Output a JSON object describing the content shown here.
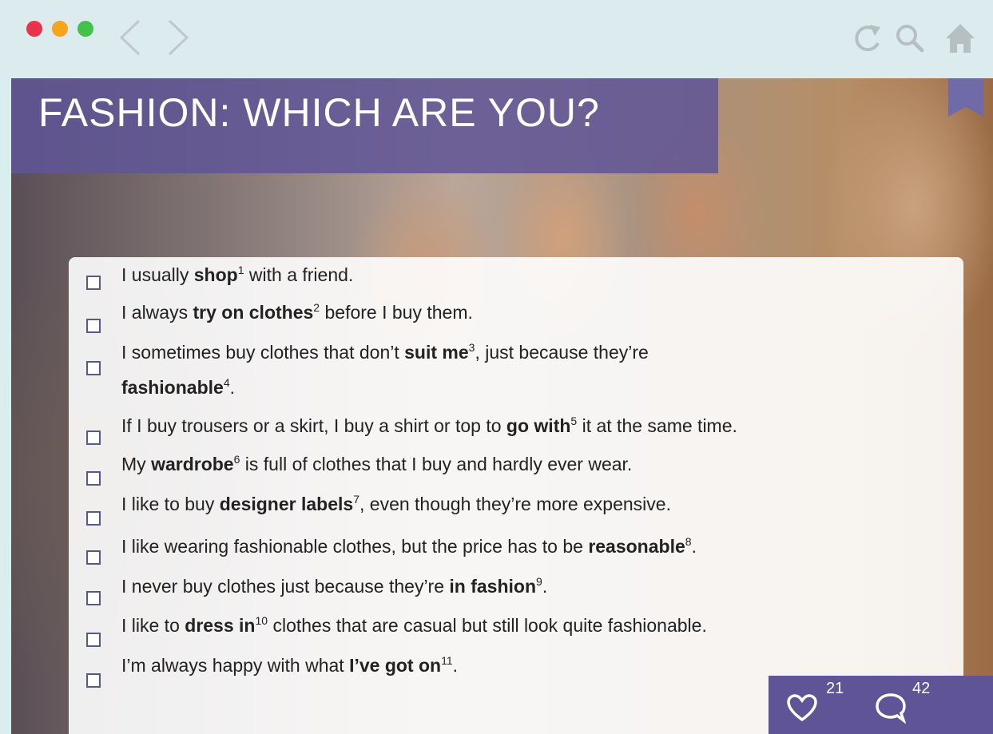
{
  "window": {
    "nav": {
      "back": "back-icon",
      "forward": "forward-icon"
    },
    "tools": [
      "reload-icon",
      "search-icon",
      "home-icon"
    ]
  },
  "colors": {
    "banner": "#5f5596",
    "panel": "#ffffff",
    "checkbox_border": "#555a8a",
    "toolbar": "#dcecee"
  },
  "page": {
    "title": "FASHION: WHICH ARE YOU?"
  },
  "checklist": [
    {
      "before": "I usually ",
      "term": "shop",
      "num": "1",
      "after": " with a friend."
    },
    {
      "before": "I always ",
      "term": "try on clothes",
      "num": "2",
      "after": " before I buy them."
    },
    {
      "before": "I sometimes buy clothes that don’t ",
      "term": "suit me",
      "num": "3",
      "after": ", just because they’re",
      "term2": "fashionable",
      "num2": "4",
      "after2": "."
    },
    {
      "before": "If I buy trousers or a skirt, I buy a shirt or top to ",
      "term": "go with",
      "num": "5",
      "after": " it at the same time."
    },
    {
      "before": "My ",
      "term": "wardrobe",
      "num": "6",
      "after": " is full of clothes that I buy and hardly ever wear."
    },
    {
      "before": "I like to buy ",
      "term": "designer labels",
      "num": "7",
      "after": ", even though they’re more expensive."
    },
    {
      "before": "I like wearing fashionable clothes, but the price has to be ",
      "term": "reasonable",
      "num": "8",
      "after": "."
    },
    {
      "before": "I never buy clothes just because they’re ",
      "term": "in fashion",
      "num": "9",
      "after": "."
    },
    {
      "before": "I like to ",
      "term": "dress in",
      "num": "10",
      "after": " clothes that are casual but still look quite fashionable."
    },
    {
      "before": "I’m always happy with what ",
      "term": "I’ve got on",
      "num": "11",
      "after": "."
    }
  ],
  "social": {
    "likes": "21",
    "comments": "42"
  }
}
